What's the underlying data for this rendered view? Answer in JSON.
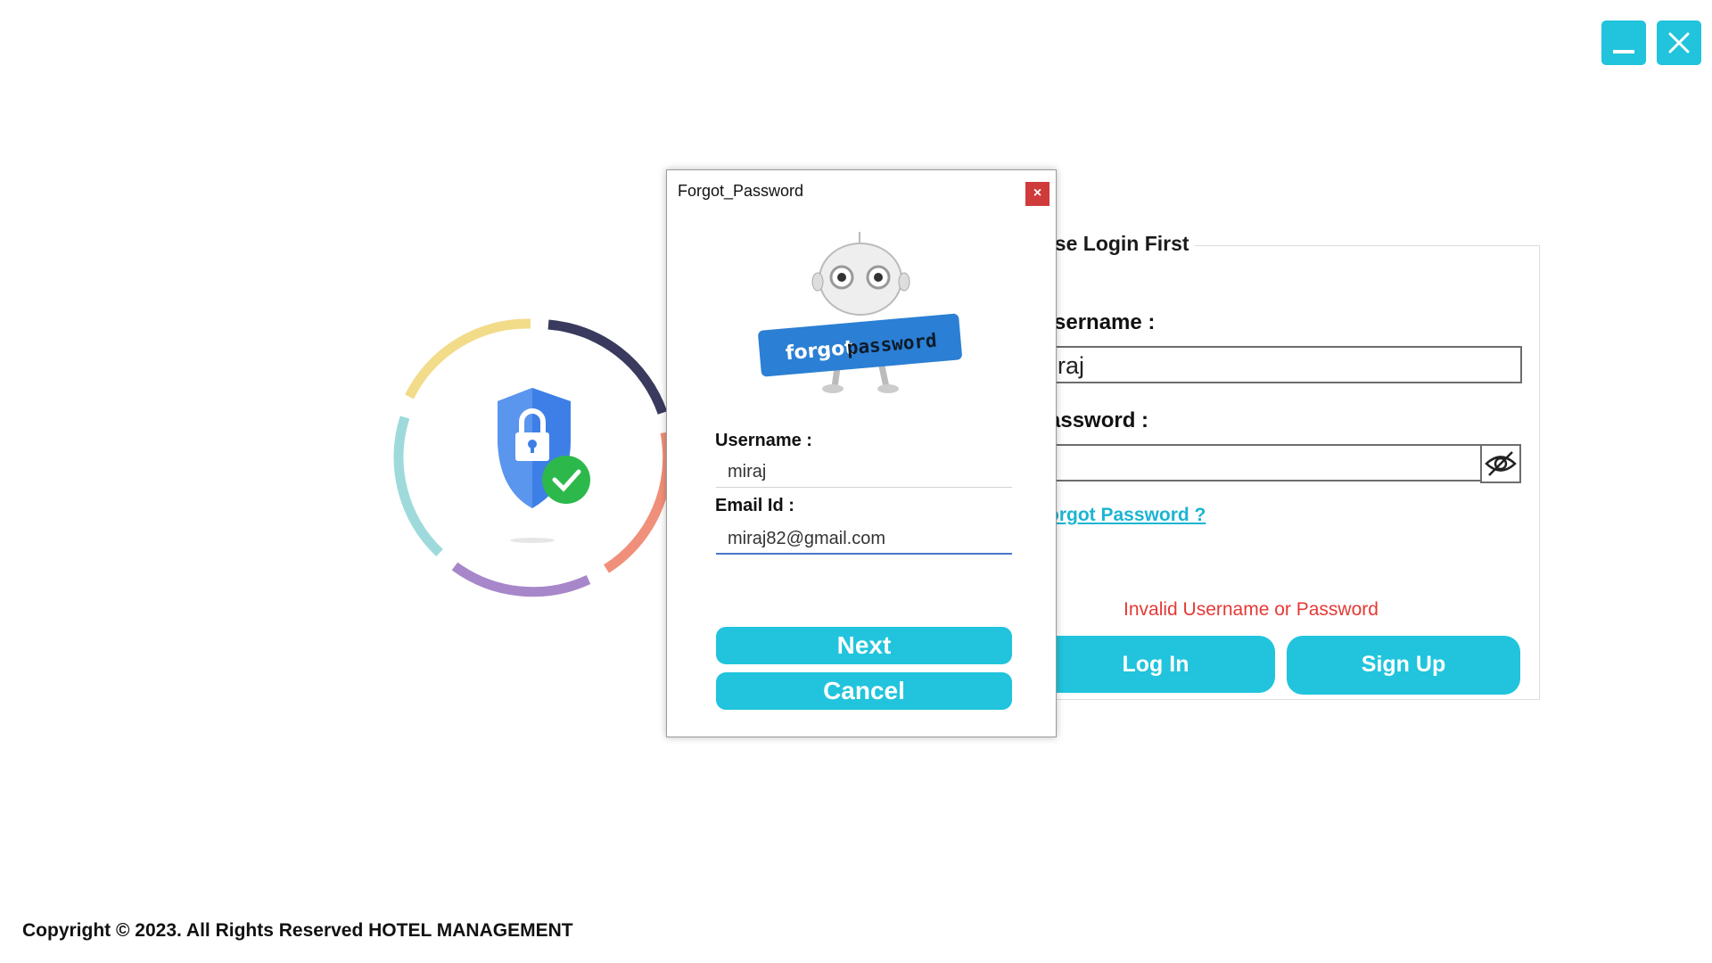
{
  "window_controls": {
    "minimize_icon": "minimize-icon",
    "close_icon": "close-icon",
    "accent": "#21c4dc"
  },
  "login_panel": {
    "legend": "ase Login First",
    "username_label": "sername :",
    "username_value": "iraj",
    "password_label": "assword :",
    "password_value": "",
    "eye_icon": "eye-slash-icon",
    "forgot_link": "orgot Password ?",
    "error_message": "Invalid Username or Password",
    "error_color": "#e53935",
    "login_button": "Log In",
    "signup_button": "Sign Up"
  },
  "dialog": {
    "title": "Forgot_Password",
    "close_label": "×",
    "close_color": "#cf3b3b",
    "image_text_1": "forgot",
    "image_text_2": "password",
    "username_label": "Username :",
    "username_value": "miraj",
    "email_label": "Email Id :",
    "email_value": "miraj82@gmail.com",
    "next_button": "Next",
    "cancel_button": "Cancel"
  },
  "footer": {
    "copyright": "Copyright © 2023. All Rights Reserved HOTEL MANAGEMENT"
  }
}
